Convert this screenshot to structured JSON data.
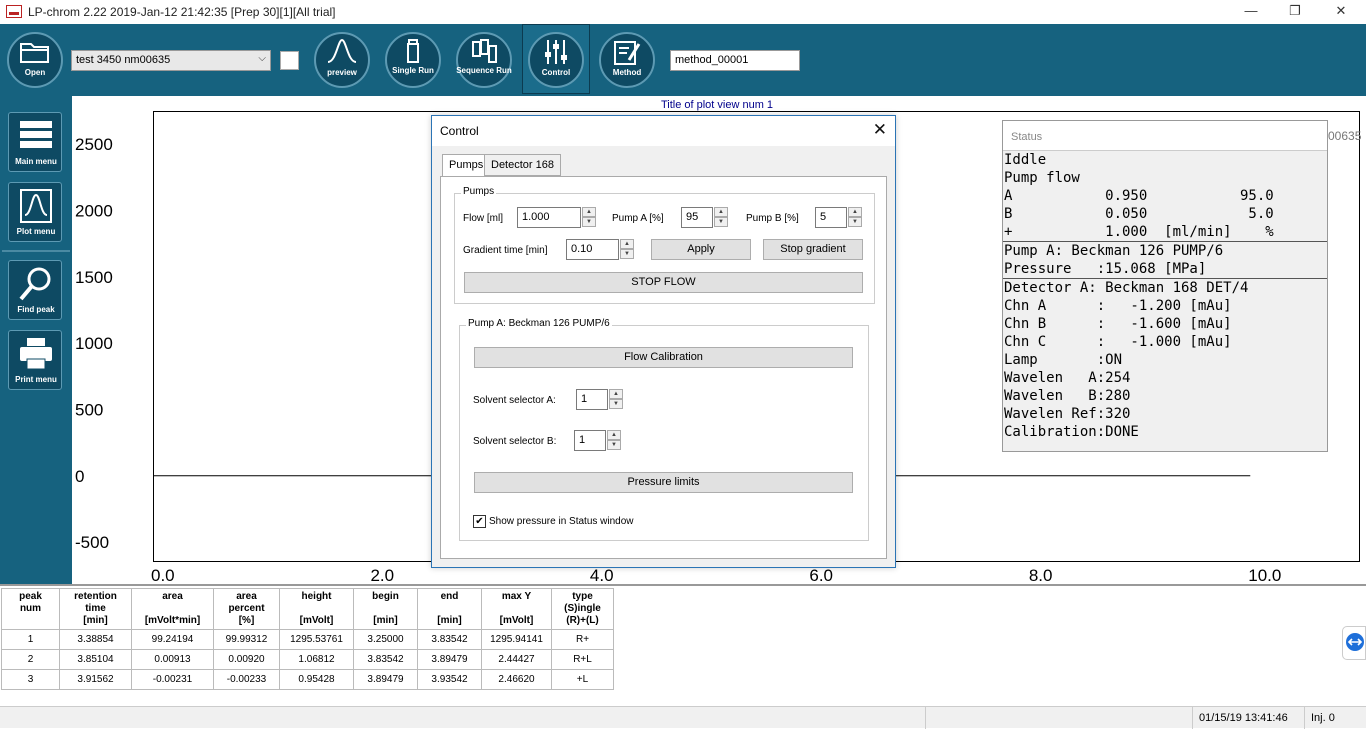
{
  "window": {
    "title": "LP-chrom 2.22 2019-Jan-12 21:42:35 [Prep 30][1][All trial]",
    "controls": [
      "—",
      "❐",
      "✕"
    ]
  },
  "toolbar": {
    "open_label": "Open",
    "file_combo_value": "test 3450 nm00635",
    "preview_label": "preview",
    "single_run_label": "Single Run",
    "sequence_run_label": "Sequence Run",
    "control_label": "Control",
    "method_label": "Method",
    "method_value": "method_00001"
  },
  "sidebar": {
    "main_menu": "Main menu",
    "plot_menu": "Plot menu",
    "find_peak": "Find peak",
    "print_menu": "Print menu"
  },
  "chart_data": {
    "type": "line",
    "title": "Title of plot view num 1",
    "yticks": [
      "2500",
      "2000",
      "1500",
      "1000",
      "500",
      "0",
      "-500"
    ],
    "xticks": [
      "0.0",
      "2.0",
      "4.0",
      "6.0",
      "8.0",
      "10.0"
    ],
    "xlim": [
      0,
      11
    ],
    "ylim": [
      -650,
      2750
    ],
    "series": [
      {
        "x": [
          0,
          10.0
        ],
        "y": [
          0,
          0
        ]
      }
    ],
    "partial_label": "00635"
  },
  "status": {
    "header": "Status",
    "lines": [
      "Iddle",
      "Pump flow",
      "A           0.950           95.0",
      "B           0.050            5.0",
      "+           1.000  [ml/min]    %",
      "Pump A: Beckman 126 PUMP/6",
      "Pressure   :15.068 [MPa]",
      "Detector A: Beckman 168 DET/4",
      "Chn A      :   -1.200 [mAu]",
      "Chn B      :   -1.600 [mAu]",
      "Chn C      :   -1.000 [mAu]",
      "Lamp       :ON",
      "Wavelen   A:254",
      "Wavelen   B:280",
      "Wavelen Ref:320",
      "Calibration:DONE"
    ]
  },
  "dialog": {
    "title": "Control",
    "close": "✕",
    "tabs": [
      "Pumps",
      "Detector 168"
    ],
    "pumps_group": "Pumps",
    "flow_label": "Flow [ml]",
    "flow_value": "1.000",
    "pump_a_label": "Pump A [%]",
    "pump_a_value": "95",
    "pump_b_label": "Pump B [%]",
    "pump_b_value": "5",
    "gradient_label": "Gradient time [min]",
    "gradient_value": "0.10",
    "apply": "Apply",
    "stop_gradient": "Stop gradient",
    "stop_flow": "STOP FLOW",
    "pump_group": "Pump A: Beckman 126 PUMP/6",
    "flow_calibration": "Flow Calibration",
    "solvent_a_label": "Solvent selector A:",
    "solvent_a_value": "1",
    "solvent_b_label": "Solvent selector B:",
    "solvent_b_value": "1",
    "pressure_limits": "Pressure limits",
    "show_pressure_label": "Show pressure in Status window",
    "show_pressure_checked": "✔"
  },
  "peaks_table": {
    "headers": [
      [
        "peak",
        "num"
      ],
      [
        "retention",
        "time",
        "[min]"
      ],
      [
        "area",
        "",
        "[mVolt*min]"
      ],
      [
        "area",
        "percent",
        "[%]"
      ],
      [
        "height",
        "",
        "[mVolt]"
      ],
      [
        "begin",
        "",
        "[min]"
      ],
      [
        "end",
        "",
        "[min]"
      ],
      [
        "max Y",
        "",
        "[mVolt]"
      ],
      [
        "type",
        "(S)ingle",
        "(R)+(L)"
      ]
    ],
    "rows": [
      [
        "1",
        "3.38854",
        "99.24194",
        "99.99312",
        "1295.53761",
        "3.25000",
        "3.83542",
        "1295.94141",
        "R+"
      ],
      [
        "2",
        "3.85104",
        "0.00913",
        "0.00920",
        "1.06812",
        "3.83542",
        "3.89479",
        "2.44427",
        "R+L"
      ],
      [
        "3",
        "3.91562",
        "-0.00231",
        "-0.00233",
        "0.95428",
        "3.89479",
        "3.93542",
        "2.46620",
        "+L"
      ]
    ]
  },
  "statusbar": {
    "datetime": "01/15/19 13:41:46",
    "inj": "Inj. 0"
  }
}
